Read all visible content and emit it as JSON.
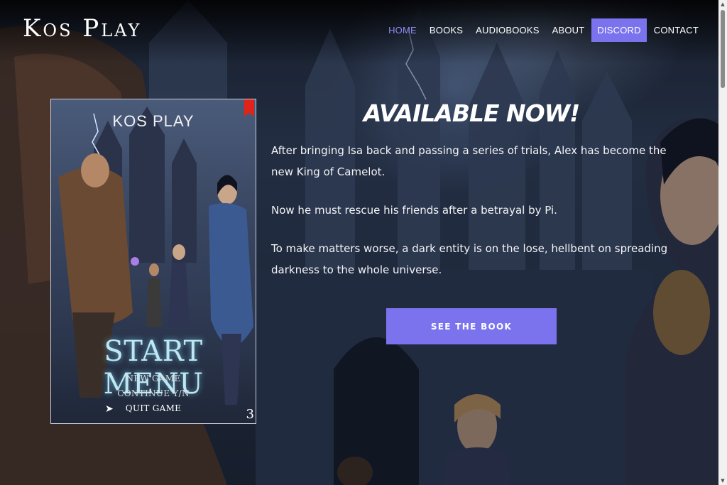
{
  "site": {
    "logo": "Kos Play"
  },
  "nav": {
    "items": [
      {
        "label": "HOME",
        "state": "active"
      },
      {
        "label": "BOOKS",
        "state": "default"
      },
      {
        "label": "AUDIOBOOKS",
        "state": "default"
      },
      {
        "label": "ABOUT",
        "state": "default"
      },
      {
        "label": "DISCORD",
        "state": "highlighted"
      },
      {
        "label": "CONTACT",
        "state": "default"
      }
    ]
  },
  "cover": {
    "author": "KOS PLAY",
    "title": "START MENU",
    "menu_items": [
      "NEW GAME",
      "CONTINUE Y/N",
      "QUIT GAME"
    ],
    "volume": "3"
  },
  "promo": {
    "headline": "AVAILABLE NOW!",
    "paragraphs": [
      "After bringing Isa back and passing a series of trials, Alex has become the new King of Camelot.",
      "Now he must rescue his friends after a betrayal by Pi.",
      "To make matters worse, a dark entity is on the lose, hellbent on spreading darkness to the whole universe."
    ],
    "button_label": "SEE THE BOOK"
  },
  "colors": {
    "accent": "#7b73ee",
    "active_nav": "#8f8cf2"
  }
}
